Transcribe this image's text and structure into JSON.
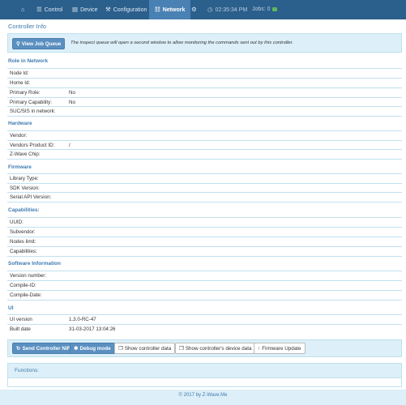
{
  "nav": {
    "home_icon": "home-icon",
    "items": [
      {
        "label": "Control",
        "icon": "sliders-icon"
      },
      {
        "label": "Device",
        "icon": "database-icon"
      },
      {
        "label": "Configuration",
        "icon": "wrench-icon"
      },
      {
        "label": "Network",
        "icon": "sitemap-icon"
      }
    ],
    "settings_icon": "gear-icon",
    "time": "02:35:34 PM",
    "jobs_label": "Jobs: 0",
    "colors": {
      "bar": "#2b5f8c",
      "active": "#4a81b4",
      "jobs_badge": "#5cb85c"
    }
  },
  "page": {
    "title": "Controller Info",
    "view_job_queue_label": "View Job Queue",
    "job_queue_note": "The inspect queue will open a second window to allow monitoring the commands sent out by this controller."
  },
  "sections": {
    "role": {
      "title": "Role in Network",
      "rows": [
        {
          "label": "Node Id:",
          "value": ""
        },
        {
          "label": "Home Id:",
          "value": ""
        },
        {
          "label": "Primary Role:",
          "value": "No"
        },
        {
          "label": "Primary Capability:",
          "value": "No"
        },
        {
          "label": "SUC/SIS in network:",
          "value": ""
        }
      ]
    },
    "hardware": {
      "title": "Hardware",
      "rows": [
        {
          "label": "Vendor:",
          "value": ""
        },
        {
          "label": "Vendors Product ID:",
          "value": "/"
        },
        {
          "label": "Z-Wave Chip:",
          "value": ""
        }
      ]
    },
    "firmware": {
      "title": "Firmware",
      "rows": [
        {
          "label": "Library Type:",
          "value": ""
        },
        {
          "label": "SDK Version:",
          "value": ""
        },
        {
          "label": "Serial API Version:",
          "value": ""
        }
      ]
    },
    "capabilities": {
      "title": "Capabilities:",
      "rows": [
        {
          "label": "UUID:",
          "value": ""
        },
        {
          "label": "Subvendor:",
          "value": ""
        },
        {
          "label": "Nodes limit:",
          "value": ""
        },
        {
          "label": "Capabilities:",
          "value": ""
        }
      ]
    },
    "software": {
      "title": "Software Information",
      "rows": [
        {
          "label": "Version number:",
          "value": ""
        },
        {
          "label": "Compile-ID:",
          "value": ""
        },
        {
          "label": "Compile-Date:",
          "value": ""
        }
      ]
    },
    "ui": {
      "title": "UI",
      "rows": [
        {
          "label": "UI version",
          "value": "1.3.0-RC-47"
        },
        {
          "label": "Built date",
          "value": "31-03-2017 13:04:26"
        }
      ]
    }
  },
  "actions": {
    "send_nif": "Send Controller NIF",
    "debug_mode": "Debug mode",
    "show_controller_data": "Show controller data",
    "show_device_data": "Show controller's device data",
    "firmware_update": "Firmware Update"
  },
  "functions": {
    "title": "Functions:"
  },
  "footer": {
    "text": "© 2017 by Z-Wave.Me"
  }
}
